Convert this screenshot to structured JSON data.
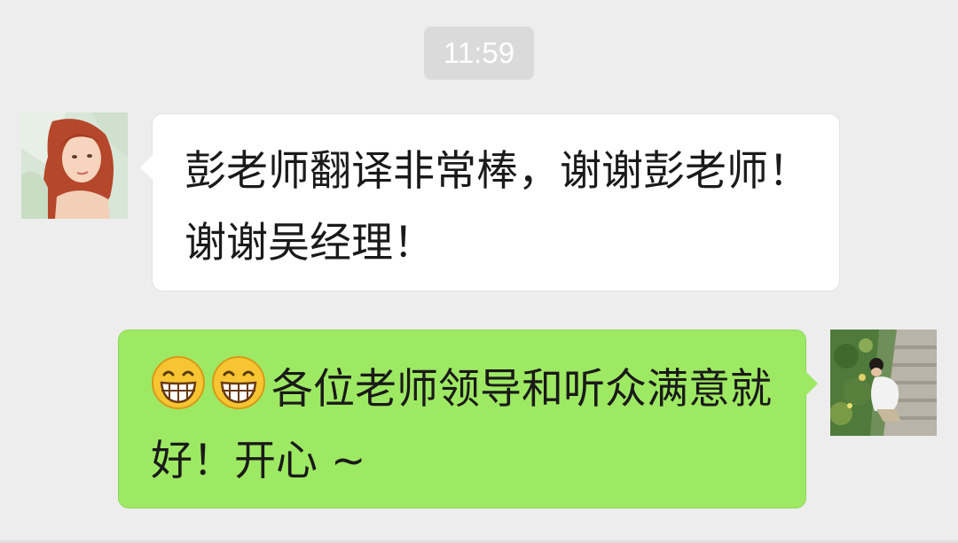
{
  "chat": {
    "timestamp": "11:59",
    "messages": [
      {
        "direction": "incoming",
        "avatar": "woman-portrait-avatar",
        "text": "彭老师翻译非常棒，谢谢彭老师！谢谢吴经理！"
      },
      {
        "direction": "outgoing",
        "avatar": "garden-photo-avatar",
        "emojis": [
          "grinning-face-emoji",
          "grinning-face-emoji"
        ],
        "text": "各位老师领导和听众满意就好！开心 ~"
      }
    ]
  },
  "colors": {
    "background": "#ededed",
    "incoming_bubble": "#ffffff",
    "outgoing_bubble": "#9ee963",
    "timestamp_pill": "#dadada"
  }
}
